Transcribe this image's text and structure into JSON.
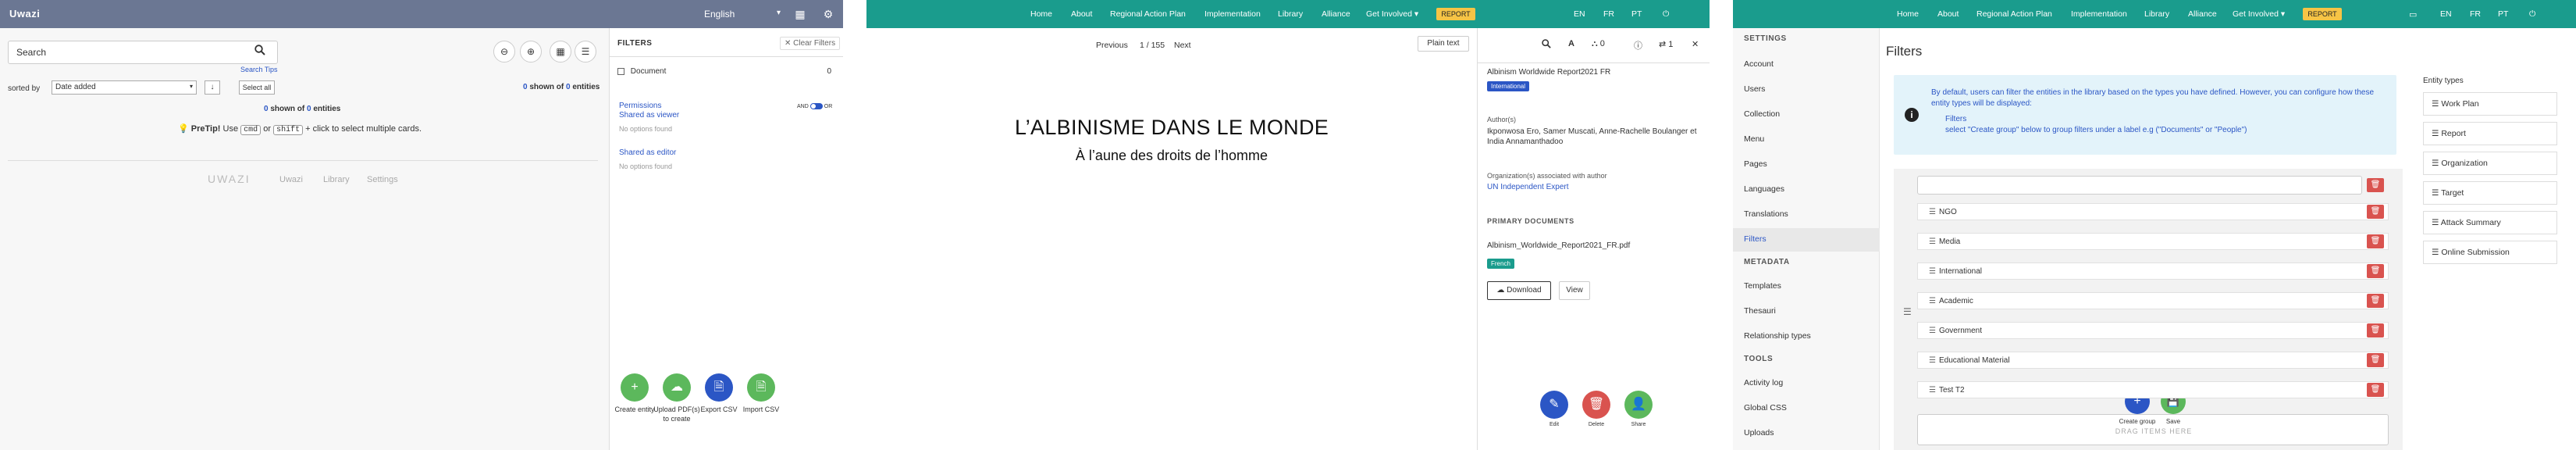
{
  "panel_a": {
    "app_title": "Uwazi",
    "language": "English",
    "search": {
      "placeholder": "Search",
      "tips": "Search Tips"
    },
    "sort": {
      "label": "sorted by",
      "value": "Date added",
      "select_all": "Select all"
    },
    "count": {
      "shown": "0",
      "shown_label": "shown of",
      "total": "0",
      "total_label": "entities"
    },
    "pretip": {
      "label": "PreTip!",
      "use": "Use",
      "key1": "cmd",
      "or": "or",
      "key2": "shift",
      "rest": "+ click to select multiple cards."
    },
    "footer": {
      "logo": "UWAZI",
      "links": [
        "Uwazi",
        "Library",
        "Settings"
      ]
    },
    "filters": {
      "title": "FILTERS",
      "clear": "Clear Filters",
      "document_label": "Document",
      "document_count": "0",
      "permissions": "Permissions",
      "shared_as_viewer": "Shared as viewer",
      "no_options_1": "No options found",
      "shared_as_editor": "Shared as editor",
      "no_options_2": "No options found",
      "toggle_and": "AND",
      "toggle_or": "OR"
    },
    "actions": [
      {
        "label": "Create entity",
        "color": "#5cb85c"
      },
      {
        "label": "Upload PDF(s) to create",
        "color": "#5cb85c"
      },
      {
        "label": "Export CSV",
        "color": "#2b56c5"
      },
      {
        "label": "Import CSV",
        "color": "#5cb85c"
      }
    ]
  },
  "nav": {
    "items": [
      "Home",
      "About",
      "Regional Action Plan",
      "Implementation",
      "Library",
      "Alliance",
      "Get Involved"
    ],
    "report": "REPORT",
    "langs": [
      "EN",
      "FR",
      "PT"
    ]
  },
  "panel_b": {
    "pager": {
      "previous": "Previous",
      "position": "1 / 155",
      "next": "Next"
    },
    "plain_text": "Plain text",
    "doc_title": "L’ALBINISME DANS LE MONDE",
    "doc_subtitle": "À l’aune des droits de l’homme",
    "toolbar": {
      "connections": "0",
      "references": "1"
    },
    "side": {
      "title": "Albinism Worldwide Report2021 FR",
      "type_badge": "International",
      "authors_label": "Author(s)",
      "authors": "Ikponwosa Ero, Samer Muscati, Anne-Rachelle Boulanger et India Annamanthadoo",
      "org_label": "Organization(s) associated with author",
      "org": "UN Independent Expert",
      "primary_label": "PRIMARY DOCUMENTS",
      "file": "Albinism_Worldwide_Report2021_FR.pdf",
      "lang_badge": "French",
      "download": "Download",
      "view": "View"
    },
    "fabs": [
      {
        "label": "Edit",
        "color": "#2b56c5"
      },
      {
        "label": "Delete",
        "color": "#d9534f"
      },
      {
        "label": "Share",
        "color": "#5cb85c"
      }
    ]
  },
  "panel_c": {
    "sidebar": {
      "settings_label": "SETTINGS",
      "settings": [
        "Account",
        "Users",
        "Collection",
        "Menu",
        "Pages",
        "Languages",
        "Translations",
        "Filters"
      ],
      "metadata_label": "METADATA",
      "metadata": [
        "Templates",
        "Thesauri",
        "Relationship types"
      ],
      "tools_label": "TOOLS",
      "tools": [
        "Activity log",
        "Global CSS",
        "Uploads"
      ]
    },
    "title": "Filters",
    "info": {
      "text": "By default, users can filter the entities in the library based on the types you have defined. However, you can configure how these entity types will be displayed:",
      "sub_title": "Filters",
      "sub_text": "select \"Create group\" below to group filters under a label e.g (\"Documents\" or \"People\")"
    },
    "groups": [
      "NGO",
      "Media",
      "International",
      "Academic",
      "Government",
      "Educational Material",
      "Test T2"
    ],
    "drag_hint": "DRAG ITEMS HERE",
    "entity_types_label": "Entity types",
    "entity_types": [
      "Work Plan",
      "Report",
      "Organization",
      "Target",
      "Attack Summary",
      "Online Submission"
    ],
    "buttons": {
      "create_group": "Create group",
      "save": "Save"
    }
  }
}
